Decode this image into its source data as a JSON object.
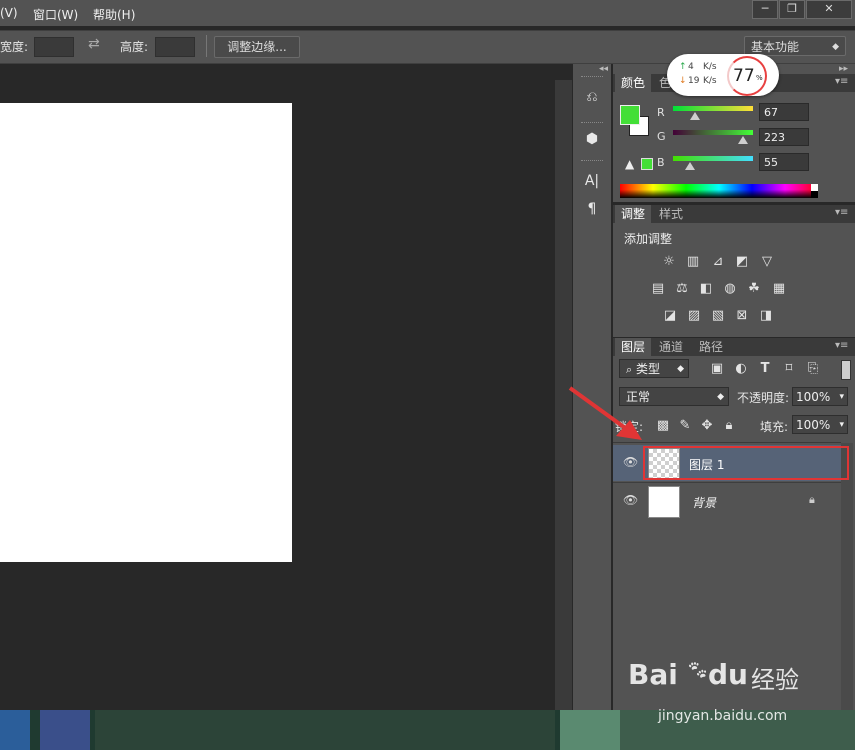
{
  "menu": {
    "view": "(V)",
    "window": "窗口(W)",
    "help": "帮助(H)"
  },
  "window_controls": {
    "minimize": "─",
    "restore": "❐",
    "close": "✕"
  },
  "options_bar": {
    "width_label": "宽度:",
    "height_label": "高度:",
    "refine_edge": "调整边缘...",
    "workspace": "基本功能"
  },
  "net_speed": {
    "up": "4",
    "up_unit": "K/s",
    "down": "19",
    "down_unit": "K/s",
    "percent": "77",
    "percent_sign": "%"
  },
  "color_panel": {
    "tabs": [
      "颜色",
      "色"
    ],
    "channels": [
      {
        "label": "R",
        "value": "67"
      },
      {
        "label": "G",
        "value": "223"
      },
      {
        "label": "B",
        "value": "55"
      }
    ],
    "foreground": "#43df37",
    "background": "#ffffff"
  },
  "adjustments_panel": {
    "tabs": [
      "调整",
      "样式"
    ],
    "title": "添加调整"
  },
  "layers_panel": {
    "tabs": [
      "图层",
      "通道",
      "路径"
    ],
    "filter": "类型",
    "blend_mode": "正常",
    "opacity_label": "不透明度:",
    "opacity": "100%",
    "lock_label": "锁定:",
    "fill_label": "填充:",
    "fill": "100%",
    "layers": [
      {
        "name": "图层 1",
        "selected": true
      },
      {
        "name": "背景",
        "selected": false
      }
    ]
  },
  "watermark": {
    "brand": "Bai",
    "brand2": "du",
    "suffix": "经验",
    "url": "jingyan.baidu.com"
  },
  "colors": {
    "accent_red": "#e03535",
    "selection_blue": "#566377"
  }
}
